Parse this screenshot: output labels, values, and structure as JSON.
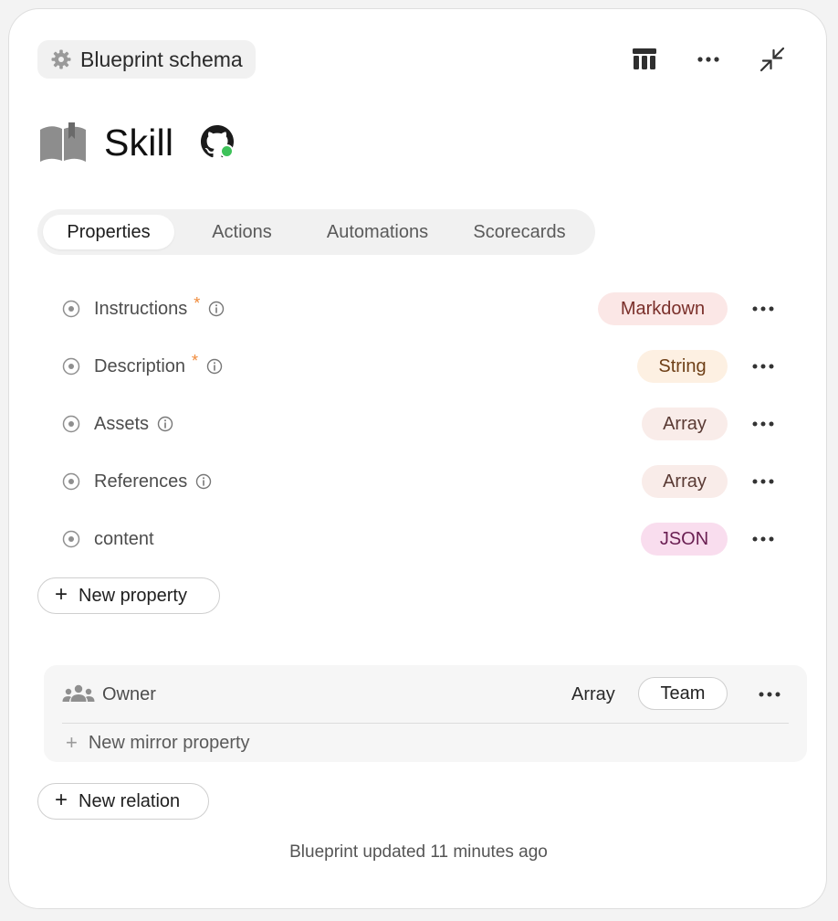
{
  "header": {
    "schema_label": "Blueprint schema"
  },
  "blueprint": {
    "title": "Skill",
    "status_color": "#3ec25a"
  },
  "tabs": [
    {
      "label": "Properties",
      "active": true
    },
    {
      "label": "Actions",
      "active": false
    },
    {
      "label": "Automations",
      "active": false
    },
    {
      "label": "Scorecards",
      "active": false
    }
  ],
  "properties": [
    {
      "name": "Instructions",
      "required": "*",
      "type": "Markdown",
      "badge_bg": "#fbe7e6",
      "badge_fg": "#7a2f2a"
    },
    {
      "name": "Description",
      "required": "*",
      "type": "String",
      "badge_bg": "#fdf0e2",
      "badge_fg": "#6e3f16"
    },
    {
      "name": "Assets",
      "required": "",
      "type": "Array",
      "badge_bg": "#f9ece9",
      "badge_fg": "#5a3a34"
    },
    {
      "name": "References",
      "required": "",
      "type": "Array",
      "badge_bg": "#f9ece9",
      "badge_fg": "#5a3a34"
    },
    {
      "name": "content",
      "required": "",
      "type": "JSON",
      "badge_bg": "#f9ddee",
      "badge_fg": "#6a1f52"
    }
  ],
  "new_property_label": "New property",
  "relation": {
    "name": "Owner",
    "type": "Array",
    "target": "Team",
    "new_mirror_label": "New mirror property"
  },
  "new_relation_label": "New relation",
  "footer": {
    "updated_text": "Blueprint updated 11 minutes ago"
  }
}
